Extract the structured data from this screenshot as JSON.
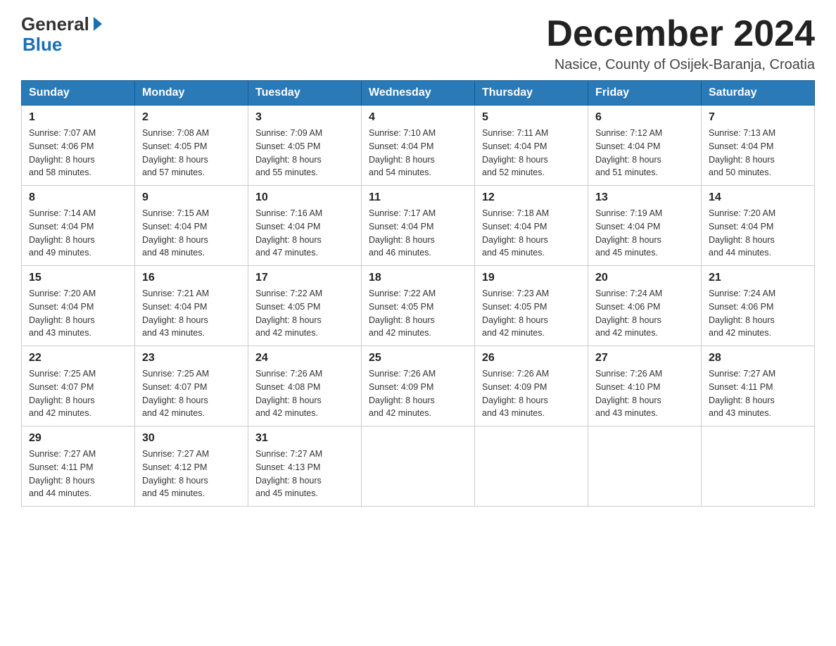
{
  "header": {
    "logo_general": "General",
    "logo_blue": "Blue",
    "month_title": "December 2024",
    "subtitle": "Nasice, County of Osijek-Baranja, Croatia"
  },
  "days_of_week": [
    "Sunday",
    "Monday",
    "Tuesday",
    "Wednesday",
    "Thursday",
    "Friday",
    "Saturday"
  ],
  "weeks": [
    [
      {
        "day": "1",
        "sunrise": "7:07 AM",
        "sunset": "4:06 PM",
        "daylight": "8 hours and 58 minutes."
      },
      {
        "day": "2",
        "sunrise": "7:08 AM",
        "sunset": "4:05 PM",
        "daylight": "8 hours and 57 minutes."
      },
      {
        "day": "3",
        "sunrise": "7:09 AM",
        "sunset": "4:05 PM",
        "daylight": "8 hours and 55 minutes."
      },
      {
        "day": "4",
        "sunrise": "7:10 AM",
        "sunset": "4:04 PM",
        "daylight": "8 hours and 54 minutes."
      },
      {
        "day": "5",
        "sunrise": "7:11 AM",
        "sunset": "4:04 PM",
        "daylight": "8 hours and 52 minutes."
      },
      {
        "day": "6",
        "sunrise": "7:12 AM",
        "sunset": "4:04 PM",
        "daylight": "8 hours and 51 minutes."
      },
      {
        "day": "7",
        "sunrise": "7:13 AM",
        "sunset": "4:04 PM",
        "daylight": "8 hours and 50 minutes."
      }
    ],
    [
      {
        "day": "8",
        "sunrise": "7:14 AM",
        "sunset": "4:04 PM",
        "daylight": "8 hours and 49 minutes."
      },
      {
        "day": "9",
        "sunrise": "7:15 AM",
        "sunset": "4:04 PM",
        "daylight": "8 hours and 48 minutes."
      },
      {
        "day": "10",
        "sunrise": "7:16 AM",
        "sunset": "4:04 PM",
        "daylight": "8 hours and 47 minutes."
      },
      {
        "day": "11",
        "sunrise": "7:17 AM",
        "sunset": "4:04 PM",
        "daylight": "8 hours and 46 minutes."
      },
      {
        "day": "12",
        "sunrise": "7:18 AM",
        "sunset": "4:04 PM",
        "daylight": "8 hours and 45 minutes."
      },
      {
        "day": "13",
        "sunrise": "7:19 AM",
        "sunset": "4:04 PM",
        "daylight": "8 hours and 45 minutes."
      },
      {
        "day": "14",
        "sunrise": "7:20 AM",
        "sunset": "4:04 PM",
        "daylight": "8 hours and 44 minutes."
      }
    ],
    [
      {
        "day": "15",
        "sunrise": "7:20 AM",
        "sunset": "4:04 PM",
        "daylight": "8 hours and 43 minutes."
      },
      {
        "day": "16",
        "sunrise": "7:21 AM",
        "sunset": "4:04 PM",
        "daylight": "8 hours and 43 minutes."
      },
      {
        "day": "17",
        "sunrise": "7:22 AM",
        "sunset": "4:05 PM",
        "daylight": "8 hours and 42 minutes."
      },
      {
        "day": "18",
        "sunrise": "7:22 AM",
        "sunset": "4:05 PM",
        "daylight": "8 hours and 42 minutes."
      },
      {
        "day": "19",
        "sunrise": "7:23 AM",
        "sunset": "4:05 PM",
        "daylight": "8 hours and 42 minutes."
      },
      {
        "day": "20",
        "sunrise": "7:24 AM",
        "sunset": "4:06 PM",
        "daylight": "8 hours and 42 minutes."
      },
      {
        "day": "21",
        "sunrise": "7:24 AM",
        "sunset": "4:06 PM",
        "daylight": "8 hours and 42 minutes."
      }
    ],
    [
      {
        "day": "22",
        "sunrise": "7:25 AM",
        "sunset": "4:07 PM",
        "daylight": "8 hours and 42 minutes."
      },
      {
        "day": "23",
        "sunrise": "7:25 AM",
        "sunset": "4:07 PM",
        "daylight": "8 hours and 42 minutes."
      },
      {
        "day": "24",
        "sunrise": "7:26 AM",
        "sunset": "4:08 PM",
        "daylight": "8 hours and 42 minutes."
      },
      {
        "day": "25",
        "sunrise": "7:26 AM",
        "sunset": "4:09 PM",
        "daylight": "8 hours and 42 minutes."
      },
      {
        "day": "26",
        "sunrise": "7:26 AM",
        "sunset": "4:09 PM",
        "daylight": "8 hours and 43 minutes."
      },
      {
        "day": "27",
        "sunrise": "7:26 AM",
        "sunset": "4:10 PM",
        "daylight": "8 hours and 43 minutes."
      },
      {
        "day": "28",
        "sunrise": "7:27 AM",
        "sunset": "4:11 PM",
        "daylight": "8 hours and 43 minutes."
      }
    ],
    [
      {
        "day": "29",
        "sunrise": "7:27 AM",
        "sunset": "4:11 PM",
        "daylight": "8 hours and 44 minutes."
      },
      {
        "day": "30",
        "sunrise": "7:27 AM",
        "sunset": "4:12 PM",
        "daylight": "8 hours and 45 minutes."
      },
      {
        "day": "31",
        "sunrise": "7:27 AM",
        "sunset": "4:13 PM",
        "daylight": "8 hours and 45 minutes."
      },
      null,
      null,
      null,
      null
    ]
  ],
  "labels": {
    "sunrise_prefix": "Sunrise: ",
    "sunset_prefix": "Sunset: ",
    "daylight_prefix": "Daylight: "
  }
}
